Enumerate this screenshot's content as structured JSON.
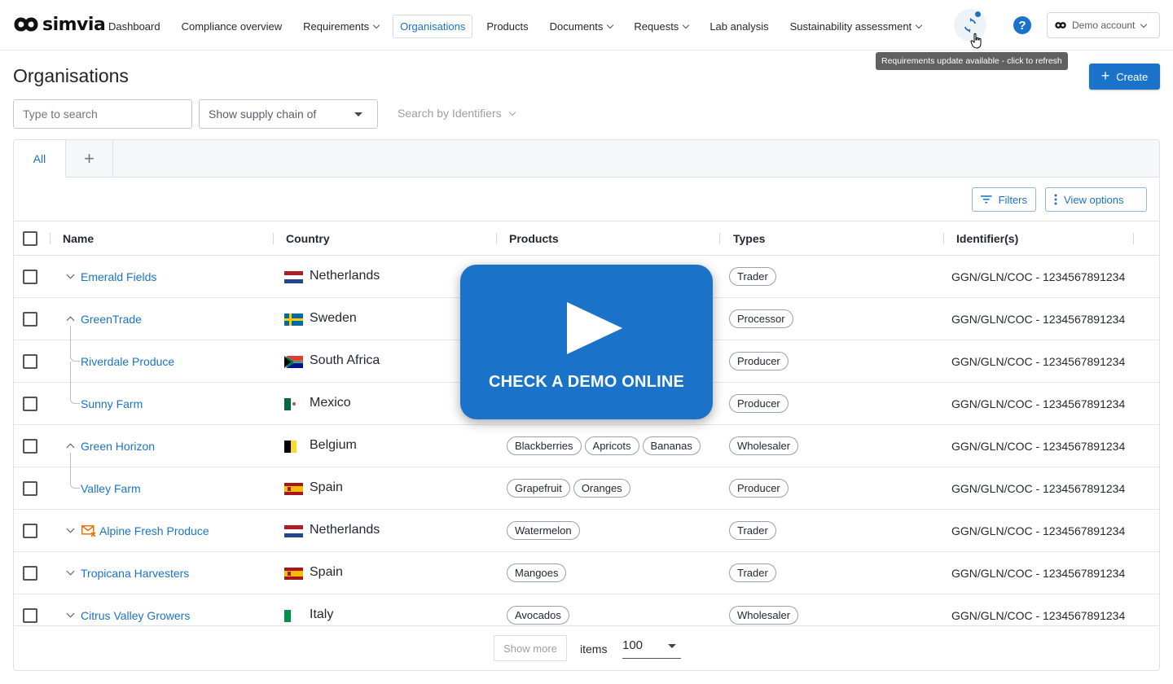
{
  "brand": {
    "name": "simvia",
    "accent": "#1a73c8"
  },
  "nav": {
    "items": [
      {
        "label": "Dashboard",
        "dropdown": false,
        "active": false
      },
      {
        "label": "Compliance overview",
        "dropdown": false,
        "active": false
      },
      {
        "label": "Requirements",
        "dropdown": true,
        "active": false
      },
      {
        "label": "Organisations",
        "dropdown": false,
        "active": true
      },
      {
        "label": "Products",
        "dropdown": false,
        "active": false
      },
      {
        "label": "Documents",
        "dropdown": true,
        "active": false
      },
      {
        "label": "Requests",
        "dropdown": true,
        "active": false
      },
      {
        "label": "Lab analysis",
        "dropdown": false,
        "active": false
      },
      {
        "label": "Sustainability assessment",
        "dropdown": true,
        "active": false
      }
    ]
  },
  "header": {
    "refresh_icon": "refresh-icon",
    "help_icon": "help-icon",
    "help_glyph": "?",
    "account_label": "Demo account",
    "tooltip": "Requirements update available - click to refresh"
  },
  "page": {
    "title": "Organisations",
    "create_label": "Create",
    "create_plus": "+",
    "search_placeholder": "Type to search",
    "supply_chain_placeholder": "Show supply chain of",
    "identifier_search_label": "Search by Identifiers"
  },
  "tabs": {
    "all_label": "All",
    "add_glyph": "+"
  },
  "toolbar": {
    "filters_label": "Filters",
    "view_options_label": "View options"
  },
  "table": {
    "columns": [
      "Name",
      "Country",
      "Products",
      "Types",
      "Identifier(s)"
    ],
    "rows": [
      {
        "name": "Emerald Fields",
        "toggle": "down",
        "child": false,
        "mail_icon": false,
        "country": "Netherlands",
        "flag": "nl",
        "products": [],
        "type": "Trader",
        "identifier": "GGN/GLN/COC - 1234567891234"
      },
      {
        "name": "GreenTrade",
        "toggle": "up",
        "child": false,
        "mail_icon": false,
        "country": "Sweden",
        "flag": "se",
        "products": [],
        "type": "Processor",
        "identifier": "GGN/GLN/COC - 1234567891234"
      },
      {
        "name": "Riverdale Produce",
        "toggle": "none",
        "child": true,
        "mail_icon": false,
        "country": "South Africa",
        "flag": "za",
        "products": [],
        "type": "Producer",
        "identifier": "GGN/GLN/COC - 1234567891234"
      },
      {
        "name": "Sunny Farm",
        "toggle": "none",
        "child": true,
        "mail_icon": false,
        "country": "Mexico",
        "flag": "mx",
        "products": [],
        "type": "Producer",
        "identifier": "GGN/GLN/COC - 1234567891234"
      },
      {
        "name": "Green Horizon",
        "toggle": "up",
        "child": false,
        "mail_icon": false,
        "country": "Belgium",
        "flag": "be",
        "products": [
          "Blackberries",
          "Apricots",
          "Bananas"
        ],
        "type": "Wholesaler",
        "identifier": "GGN/GLN/COC - 1234567891234"
      },
      {
        "name": "Valley Farm",
        "toggle": "none",
        "child": true,
        "mail_icon": false,
        "country": "Spain",
        "flag": "es",
        "products": [
          "Grapefruit",
          "Oranges"
        ],
        "type": "Producer",
        "identifier": "GGN/GLN/COC - 1234567891234"
      },
      {
        "name": "Alpine Fresh Produce",
        "toggle": "down",
        "child": false,
        "mail_icon": true,
        "country": "Netherlands",
        "flag": "nl",
        "products": [
          "Watermelon"
        ],
        "type": "Trader",
        "identifier": "GGN/GLN/COC - 1234567891234"
      },
      {
        "name": "Tropicana Harvesters",
        "toggle": "down",
        "child": false,
        "mail_icon": false,
        "country": "Spain",
        "flag": "es",
        "products": [
          "Mangoes"
        ],
        "type": "Trader",
        "identifier": "GGN/GLN/COC - 1234567891234"
      },
      {
        "name": "Citrus Valley Growers",
        "toggle": "down",
        "child": false,
        "mail_icon": false,
        "country": "Italy",
        "flag": "it",
        "products": [
          "Avocados"
        ],
        "type": "Wholesaler",
        "identifier": "GGN/GLN/COC - 1234567891234"
      }
    ]
  },
  "footer": {
    "show_more_label": "Show more",
    "items_label": "items",
    "items_value": "100"
  },
  "overlay": {
    "play_icon": "play-icon",
    "text": "CHECK A DEMO ONLINE",
    "color": "#1a73c8"
  }
}
